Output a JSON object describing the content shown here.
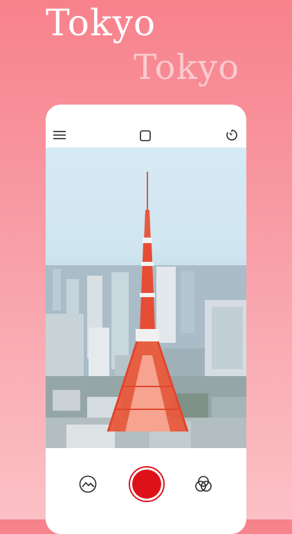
{
  "header": {
    "title": "Tokyo",
    "title_echo": "Tokyo"
  },
  "camera": {
    "top_icons": [
      "menu-icon",
      "frame-icon",
      "timer-icon"
    ],
    "bottom_icons": [
      "gallery-icon",
      "shutter-button",
      "filters-icon"
    ],
    "accent_color": "#dd1218"
  }
}
